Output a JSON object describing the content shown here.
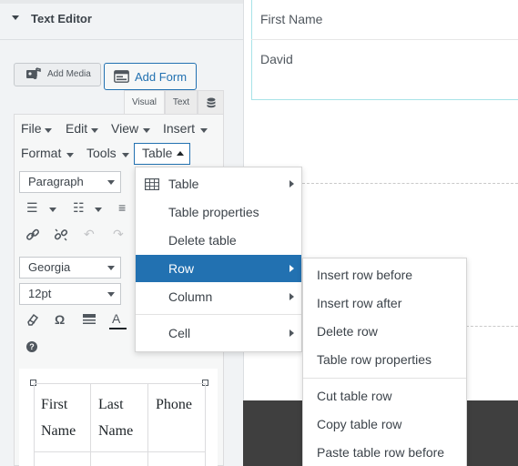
{
  "panel": {
    "section_title": "Text Editor"
  },
  "toolbar": {
    "add_media_label": "Add Media",
    "add_form_label": "Add Form"
  },
  "tabs": {
    "visual": "Visual",
    "text": "Text"
  },
  "menubar": {
    "row1": [
      "File",
      "Edit",
      "View",
      "Insert"
    ],
    "row2": [
      "Format",
      "Tools"
    ],
    "table": "Table"
  },
  "format_controls": {
    "block_format": "Paragraph",
    "font_family": "Georgia",
    "font_size": "12pt"
  },
  "doc_table": {
    "headers": [
      [
        "First",
        "Name"
      ],
      [
        "Last",
        "Name"
      ],
      [
        "Phone",
        ""
      ]
    ]
  },
  "preview": {
    "field1": "First Name",
    "field2": "David"
  },
  "table_menu": {
    "items": [
      "Table",
      "Table properties",
      "Delete table",
      "Row",
      "Column",
      "Cell"
    ],
    "active_item": "Row"
  },
  "row_submenu": {
    "items": [
      "Insert row before",
      "Insert row after",
      "Delete row",
      "Table row properties",
      "Cut table row",
      "Copy table row",
      "Paste table row before"
    ]
  },
  "icons": {
    "section_caret": "caret-down-icon",
    "add_media": "media-icon",
    "add_form": "form-icon",
    "tab_db": "database-icon",
    "table_menu_table": "table-grid-icon"
  },
  "colors": {
    "accent": "#2271b1",
    "panel_bg": "#f1f3f5",
    "preview_border": "#a7e3e8",
    "dark_band": "#3f3f3f"
  }
}
